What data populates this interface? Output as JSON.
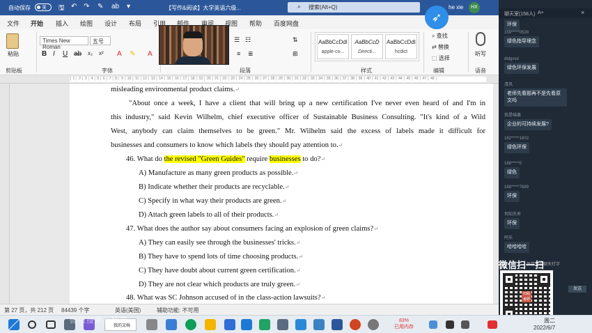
{
  "titlebar": {
    "autosave": "自动保存",
    "toggle_state": "关",
    "doc_title": "【写作&阅读】大学英语六级...",
    "search_placeholder": "搜索(Alt+Q)",
    "user_name": "he xie",
    "user_initials": "HX"
  },
  "tabs": [
    "文件",
    "开始",
    "插入",
    "绘图",
    "设计",
    "布局",
    "引用",
    "邮件",
    "审阅",
    "视图",
    "帮助",
    "百度网盘"
  ],
  "ribbon": {
    "paste": "粘贴",
    "clipboard_group": "剪贴板",
    "font_name": "Times New Roman",
    "font_size": "五号",
    "font_group": "字体",
    "paragraph_group": "段落",
    "styles_group": "样式",
    "editing_group": "编辑",
    "voice_group": "语音",
    "styles": [
      {
        "preview": "AaBbCcDdI",
        "name": "apple-co..."
      },
      {
        "preview": "AaBbCcD",
        "name": "Directi..."
      },
      {
        "preview": "AaBbCcDdI",
        "name": "hcdict"
      }
    ],
    "find": "查找",
    "replace": "替换",
    "select": "选择",
    "dictate": "听写"
  },
  "document": {
    "line_top": "misleading environmental product claims.",
    "para_lines": [
      "\"About once a week, I have a client that will bring up a new certification I've never even heard of and I'm in",
      "this industry,\" said Kevin Wilhelm, chief executive officer of Sustainable Business Consulting. \"It's kind of a Wild",
      "West, anybody can claim themselves to be green.\" Mr. Wilhelm said the excess of labels made it difficult for",
      "businesses and consumers to know which labels they should pay attention to."
    ],
    "q46": {
      "prefix": "46. What do ",
      "hl1": "the revised \"Green Guides\"",
      "mid": " require ",
      "hl2": "businesses",
      "suffix": " to do?",
      "options": [
        "A) Manufacture as many green products as possible.",
        "B) Indicate whether their products are recyclable.",
        "C) Specify in what way their products are green.",
        "D) Attach green labels to all of their products."
      ]
    },
    "q47": {
      "question": "47. What does the author say about consumers facing an explosion of green claims?",
      "options": [
        "A) They can easily see through the businesses' tricks.",
        "B) They have to spend lots of time choosing products.",
        "C) They have doubt about current green certification.",
        "D) They are not clear which products are truly green."
      ]
    },
    "q48": "48. What was SC Johnson accused of in the class-action lawsuits?"
  },
  "statusbar": {
    "page": "第 27 页，共 212 页",
    "words": "84439 个字",
    "lang": "英语(美国)",
    "access": "辅助功能: 不可用"
  },
  "chat": {
    "header": "聊天室(158人)",
    "font_toggle": "A+",
    "close": "×",
    "messages": [
      {
        "name": "",
        "text": "环保"
      },
      {
        "name": "159*****0528",
        "text": "绿色指导理念"
      },
      {
        "name": "dldgvsd",
        "text": "绿色环保发展"
      },
      {
        "name": "清风",
        "text": "老师先看题再不是先看原文吗"
      },
      {
        "name": "我是喵酱",
        "text": "企业的可持续发展?"
      },
      {
        "name": "182*****1802",
        "text": "绿色环保"
      },
      {
        "name": "188*****0",
        "text": "绿色"
      },
      {
        "name": "188*****7689",
        "text": "环保"
      },
      {
        "name": "何知夫来",
        "text": "环保"
      },
      {
        "name": "阿乐",
        "text": "哈哈哈哈"
      }
    ],
    "input_hint": "屏幕点击聊天打字",
    "send": "发送"
  },
  "wechat": {
    "title": "微信扫一扫",
    "qr_center": "扫码考研"
  },
  "taskbar": {
    "search_text": "我的文档",
    "tray_percent": "83%",
    "tray_label": "已用内存",
    "time": "周二",
    "date": "2022/6/7",
    "watermark": "微信搜索小程序"
  }
}
